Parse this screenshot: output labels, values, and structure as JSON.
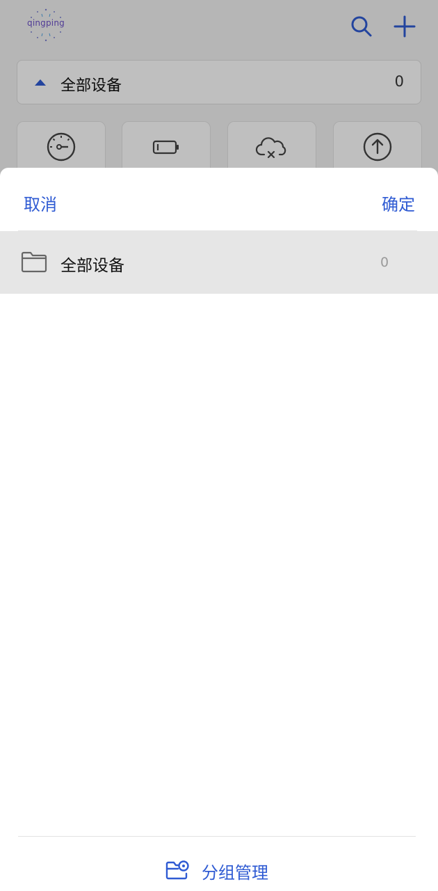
{
  "app": {
    "logo_text": "qingping",
    "group_selector": {
      "label": "全部设备",
      "count": "0"
    },
    "filters": [
      {
        "icon": "speedometer-icon"
      },
      {
        "icon": "battery-icon"
      },
      {
        "icon": "cloud-offline-icon"
      },
      {
        "icon": "upload-icon"
      }
    ]
  },
  "sheet": {
    "cancel_label": "取消",
    "confirm_label": "确定",
    "groups": [
      {
        "name": "全部设备",
        "count": "0",
        "selected": true
      }
    ],
    "manage_label": "分组管理"
  },
  "colors": {
    "accent": "#2f5bd3",
    "selected_row": "#e6e6e6",
    "muted_text": "#9a9a9a"
  }
}
